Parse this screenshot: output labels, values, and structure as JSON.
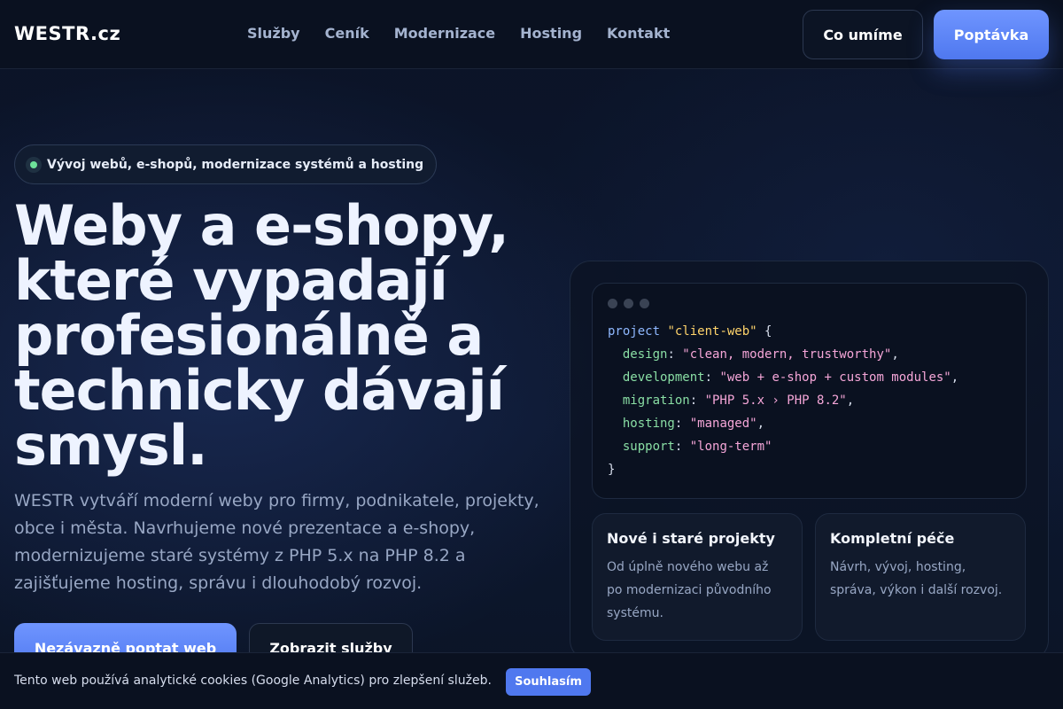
{
  "header": {
    "logo": "WESTR.cz",
    "nav": [
      "Služby",
      "Ceník",
      "Modernizace",
      "Hosting",
      "Kontakt"
    ],
    "secondary_button": "Co umíme",
    "primary_button": "Poptávka"
  },
  "hero": {
    "badge": "Vývoj webů, e-shopů, modernizace systémů a hosting",
    "headline": "Weby a e-shopy, které vypadají profesionálně a technicky dávají smysl.",
    "lead": "WESTR vytváří moderní weby pro firmy, podnikatele, projekty, obce i města. Navrhujeme nové prezentace a e-shopy, modernizujeme staré systémy z PHP 5.x na PHP 8.2 a zajišťujeme hosting, správu i dlouhodobý rozvoj.",
    "cta_primary": "Nezávazně poptat web",
    "cta_secondary": "Zobrazit služby"
  },
  "code_card": {
    "keyword": "project",
    "name": "\"client-web\"",
    "open": "{",
    "close": "}",
    "lines": [
      {
        "key": "design",
        "value": "\"clean, modern, trustworthy\"",
        "trail": ","
      },
      {
        "key": "development",
        "value": "\"web + e-shop + custom modules\"",
        "trail": ","
      },
      {
        "key": "migration",
        "value": "\"PHP 5.x › PHP 8.2\"",
        "trail": ","
      },
      {
        "key": "hosting",
        "value": "\"managed\"",
        "trail": ","
      },
      {
        "key": "support",
        "value": "\"long-term\"",
        "trail": ""
      }
    ]
  },
  "features": [
    {
      "title": "Nové i staré projekty",
      "text": "Od úplně nového webu až po modernizaci původního systému."
    },
    {
      "title": "Kompletní péče",
      "text": "Návrh, vývoj, hosting, správa, výkon i další rozvoj."
    }
  ],
  "cookie": {
    "text": "Tento web používá analytické cookies (Google Analytics) pro zlepšení služeb.",
    "button": "Souhlasím"
  },
  "colors": {
    "accent": "#5b84f6",
    "status_dot": "#6ee29a",
    "background": "#0b1222"
  }
}
